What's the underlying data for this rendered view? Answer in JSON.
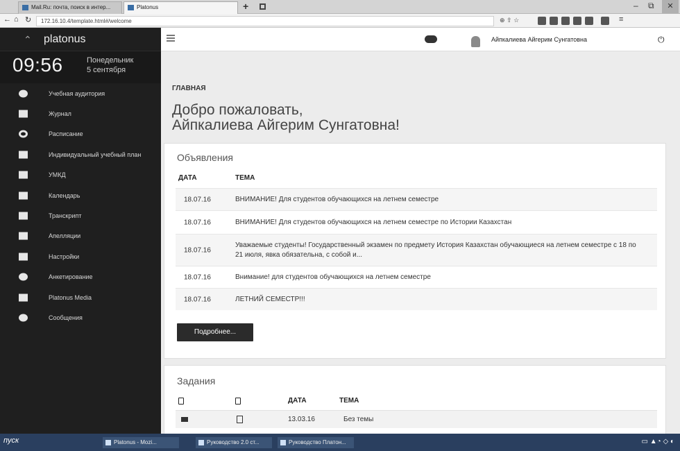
{
  "browser": {
    "tabs": [
      {
        "title": "Mail.Ru: почта, поиск в интер..."
      },
      {
        "title": "Platonus"
      }
    ],
    "url": "172.16.10.4/template.html#/welcome"
  },
  "sidebar": {
    "brand": "platonus",
    "time": "09:56",
    "weekday": "Понедельник",
    "date": "5 сентября",
    "items": [
      {
        "label": "Учебная аудитория",
        "icon": "users-icon"
      },
      {
        "label": "Журнал",
        "icon": "journal-icon"
      },
      {
        "label": "Расписание",
        "icon": "clock-icon"
      },
      {
        "label": "Индивидуальный учебный план",
        "icon": "grid-icon"
      },
      {
        "label": "УМКД",
        "icon": "book-icon"
      },
      {
        "label": "Календарь",
        "icon": "calendar-icon"
      },
      {
        "label": "Транскрипт",
        "icon": "table-icon"
      },
      {
        "label": "Апелляции",
        "icon": "gavel-icon"
      },
      {
        "label": "Настройки",
        "icon": "wrench-icon"
      },
      {
        "label": "Анкетирование",
        "icon": "check-circle-icon"
      },
      {
        "label": "Platonus Media",
        "icon": "play-icon"
      },
      {
        "label": "Сообщения",
        "icon": "chat-icon"
      }
    ]
  },
  "header": {
    "user_name": "Айпкалиева Айгерим Сунгатовна"
  },
  "main": {
    "breadcrumb": "ГЛАВНАЯ",
    "welcome_line1": "Добро пожаловать,",
    "welcome_line2": "Айпкалиева Айгерим Сунгатовна!",
    "announcements": {
      "title": "Объявления",
      "col_date": "ДАТА",
      "col_topic": "ТЕМА",
      "rows": [
        {
          "date": "18.07.16",
          "topic": "ВНИМАНИЕ! Для студентов обучающихся на летнем семестре"
        },
        {
          "date": "18.07.16",
          "topic": "ВНИМАНИЕ! Для студентов обучающихся на летнем семестре по Истории Казахстан"
        },
        {
          "date": "18.07.16",
          "topic": "Уважаемые студенты! Государственный экзамен по предмету История Казахстан обучающиеся на летнем семестре с 18 по 21 июля, явка обязательна, с собой и..."
        },
        {
          "date": "18.07.16",
          "topic": "Внимание! для студентов обучающихся на летнем семестре"
        },
        {
          "date": "18.07.16",
          "topic": "ЛЕТНИЙ СЕМЕСТР!!!"
        }
      ],
      "more_button": "Подробнее..."
    },
    "tasks": {
      "title": "Задания",
      "col_date": "ДАТА",
      "col_topic": "ТЕМА",
      "rows": [
        {
          "date": "13.03.16",
          "topic": "Без темы"
        }
      ]
    }
  },
  "taskbar": {
    "start": "пуск",
    "items": [
      {
        "label": "Platonus - Mozi..."
      },
      {
        "label": "Руководство 2.0 ст..."
      },
      {
        "label": "Руководство Платон..."
      }
    ]
  }
}
